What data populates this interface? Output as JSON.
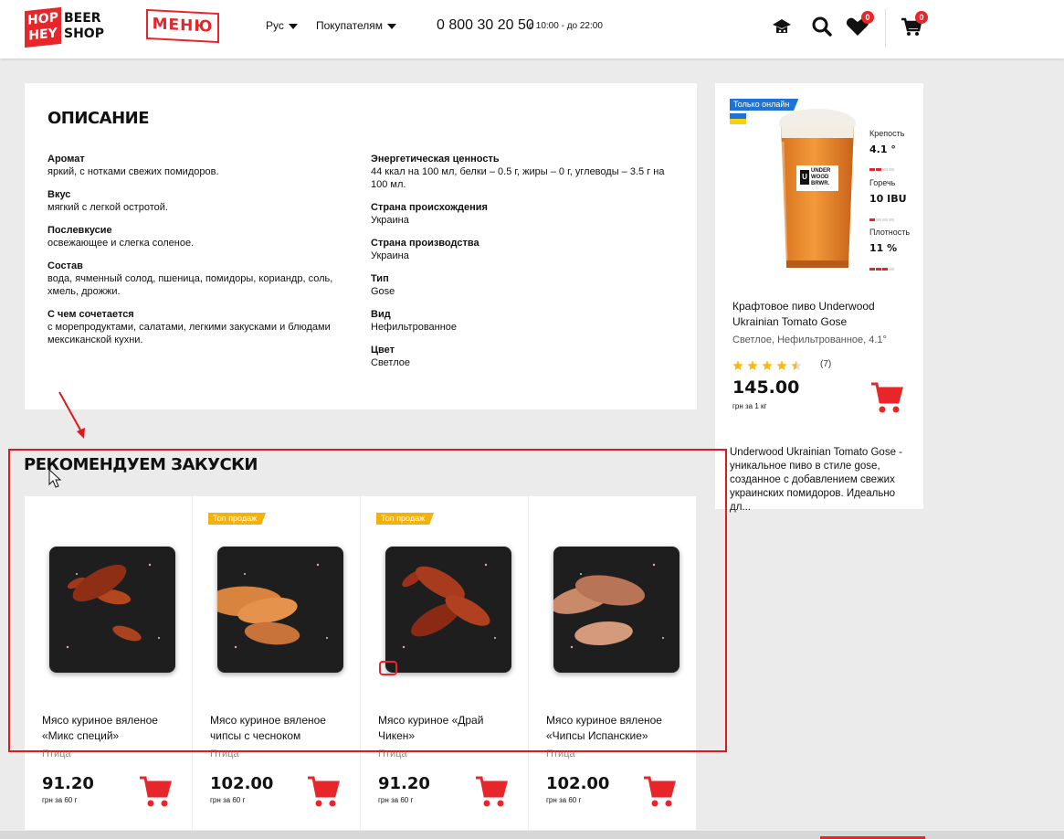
{
  "header": {
    "logo_left": "HOP\nHEY",
    "logo_right": "BEER\nSHOP",
    "menu_label": "МЕНЮ",
    "language": "Рус",
    "customers": "Покупателям",
    "phone": "0 800 30 20 50",
    "hours": "с 10:00 - до 22:00",
    "wishlist_count": "0",
    "cart_count": "0",
    "icons": [
      "hat-icon",
      "search-icon",
      "heart-icon",
      "cart-icon"
    ]
  },
  "description": {
    "title": "ОПИСАНИЕ",
    "left": [
      {
        "label": "Аромат",
        "value": "яркий, с нотками свежих помидоров."
      },
      {
        "label": "Вкус",
        "value": "мягкий с легкой остротой."
      },
      {
        "label": "Послевкусие",
        "value": "освежающее и слегка соленое."
      },
      {
        "label": "Состав",
        "value": "вода, ячменный солод, пшеница, помидоры, кориандр, соль, хмель, дрожжи."
      },
      {
        "label": "С чем сочетается",
        "value": "с морепродуктами, салатами, легкими закусками и блюдами мексиканской кухни."
      }
    ],
    "right": [
      {
        "label": "Энергетическая ценность",
        "value": "44 ккал на 100 мл, белки – 0.5 г, жиры – 0 г, углеводы – 3.5 г на 100 мл."
      },
      {
        "label": "Страна происхождения",
        "value": "Украина"
      },
      {
        "label": "Страна производства",
        "value": "Украина"
      },
      {
        "label": "Тип",
        "value": "Gose"
      },
      {
        "label": "Вид",
        "value": "Нефильтрованное"
      },
      {
        "label": "Цвет",
        "value": "Светлое"
      }
    ]
  },
  "recommend": {
    "title": "РЕКОМЕНДУЕМ ЗАКУСКИ",
    "top_label": "Топ продаж",
    "products": [
      {
        "name": "Мясо куриное вяленое «Микс специй»",
        "category": "Птица",
        "price": "91.20",
        "unit": "грн за 60 г",
        "top": false
      },
      {
        "name": "Мясо куриное вяленое чипсы с чесноком",
        "category": "Птица",
        "price": "102.00",
        "unit": "грн за 60 г",
        "top": true
      },
      {
        "name": "Мясо куриное «Драй Чикен»",
        "category": "Птица",
        "price": "91.20",
        "unit": "грн за 60 г",
        "top": true
      },
      {
        "name": "Мясо куриное вяленое «Чипсы Испанские»",
        "category": "Птица",
        "price": "102.00",
        "unit": "грн за 60 г",
        "top": false
      }
    ]
  },
  "sidebar": {
    "badge": "Только онлайн",
    "brand_on_glass": "UNDER\nWOOD\nBRWR.",
    "stats": [
      {
        "label": "Крепость",
        "value": "4.1 °",
        "level": 2
      },
      {
        "label": "Горечь",
        "value": "10 IBU",
        "level": 1
      },
      {
        "label": "Плотность",
        "value": "11 %",
        "level": 3
      }
    ],
    "name": "Крафтовое пиво Underwood Ukrainian Tomato Gose",
    "subtitle": "Светлое, Нефильтрованное, 4.1°",
    "rating": 4.5,
    "reviews": "(7)",
    "price": "145.00",
    "unit": "грн за 1 кг",
    "description": "Underwood Ukrainian Tomato Gose - уникальное пиво в стиле gose, созданное с добавлением свежих украинских помидоров. Идеально дл..."
  },
  "colors": {
    "accent": "#e8262a",
    "top_badge": "#f3b10d",
    "online_badge": "#1e74d4",
    "star": "#f5b90a"
  }
}
